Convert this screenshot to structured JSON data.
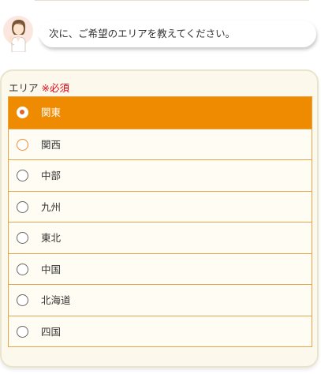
{
  "chat": {
    "avatar_icon": "operator-woman-icon",
    "message": "次に、ご希望のエリアを教えてください。"
  },
  "form": {
    "label": "エリア",
    "required_mark": "※必須",
    "selected_value": "関東",
    "options": [
      {
        "label": "関東",
        "selected": true
      },
      {
        "label": "関西",
        "selected": false
      },
      {
        "label": "中部",
        "selected": false
      },
      {
        "label": "九州",
        "selected": false
      },
      {
        "label": "東北",
        "selected": false
      },
      {
        "label": "中国",
        "selected": false
      },
      {
        "label": "北海道",
        "selected": false
      },
      {
        "label": "四国",
        "selected": false
      }
    ]
  },
  "colors": {
    "accent": "#ef8b00",
    "required": "#e60012",
    "card_background": "#fcf9ec",
    "option_border": "#e3a44a"
  }
}
